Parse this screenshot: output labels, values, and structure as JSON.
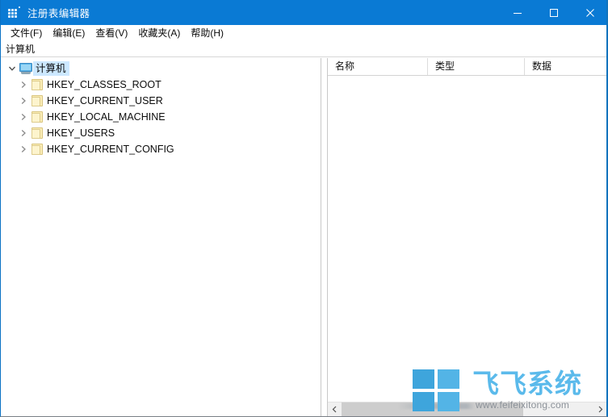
{
  "window": {
    "title": "注册表编辑器",
    "icon": "registry-grid-icon",
    "titlebar_color": "#0a7ad4",
    "controls": {
      "minimize": "—",
      "maximize": "□",
      "close": "×"
    }
  },
  "menubar": {
    "items": [
      {
        "label": "文件(F)"
      },
      {
        "label": "编辑(E)"
      },
      {
        "label": "查看(V)"
      },
      {
        "label": "收藏夹(A)"
      },
      {
        "label": "帮助(H)"
      }
    ]
  },
  "address": {
    "path": "计算机"
  },
  "tree": {
    "root": {
      "label": "计算机",
      "expanded": true,
      "selected": true,
      "icon": "computer-icon"
    },
    "children": [
      {
        "label": "HKEY_CLASSES_ROOT",
        "expanded": false,
        "icon": "folder-icon"
      },
      {
        "label": "HKEY_CURRENT_USER",
        "expanded": false,
        "icon": "folder-icon"
      },
      {
        "label": "HKEY_LOCAL_MACHINE",
        "expanded": false,
        "icon": "folder-icon"
      },
      {
        "label": "HKEY_USERS",
        "expanded": false,
        "icon": "folder-icon"
      },
      {
        "label": "HKEY_CURRENT_CONFIG",
        "expanded": false,
        "icon": "folder-icon"
      }
    ]
  },
  "value_list": {
    "columns": [
      {
        "label": "名称"
      },
      {
        "label": "类型"
      },
      {
        "label": "数据"
      }
    ],
    "rows": []
  },
  "scrollbar": {
    "left_arrow": "‹",
    "right_arrow": "›"
  },
  "watermark": {
    "brand": "飞飞系统",
    "url": "www.feifeixitong.com",
    "logo": "windows-logo",
    "color": "#5bbaeb"
  }
}
